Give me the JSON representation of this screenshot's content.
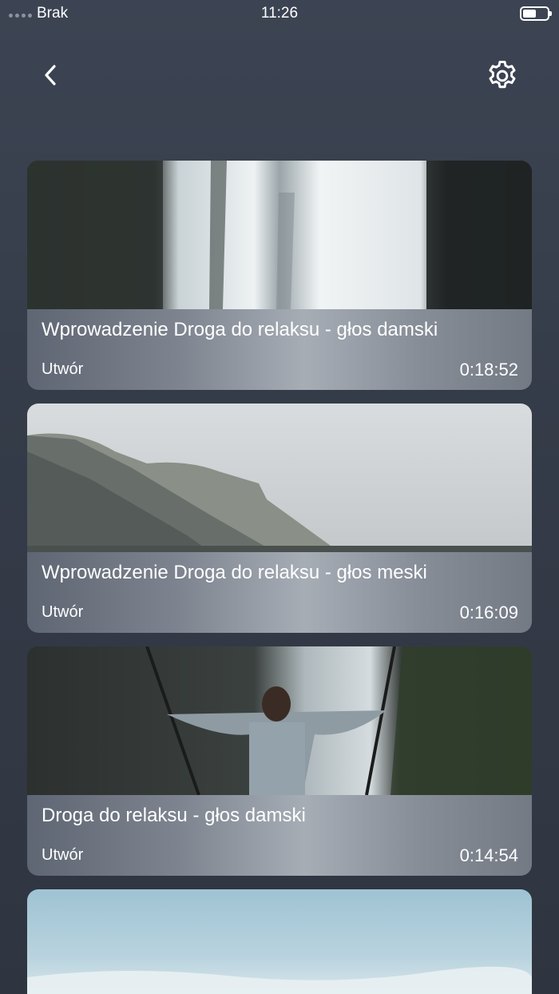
{
  "status_bar": {
    "carrier": "Brak",
    "time": "11:26"
  },
  "header": {
    "back_icon": "chevron-left-icon",
    "settings_icon": "gear-icon"
  },
  "tracks": [
    {
      "title": "Wprowadzenie Droga do relaksu - głos damski",
      "type": "Utwór",
      "duration": "0:18:52",
      "image": "waterfall-photo"
    },
    {
      "title": "Wprowadzenie Droga do relaksu - głos meski",
      "type": "Utwór",
      "duration": "0:16:09",
      "image": "misty-mountain-photo"
    },
    {
      "title": "Droga do relaksu - głos damski",
      "type": "Utwór",
      "duration": "0:14:54",
      "image": "woman-on-swing-photo"
    },
    {
      "image": "sky-landscape-photo"
    }
  ]
}
